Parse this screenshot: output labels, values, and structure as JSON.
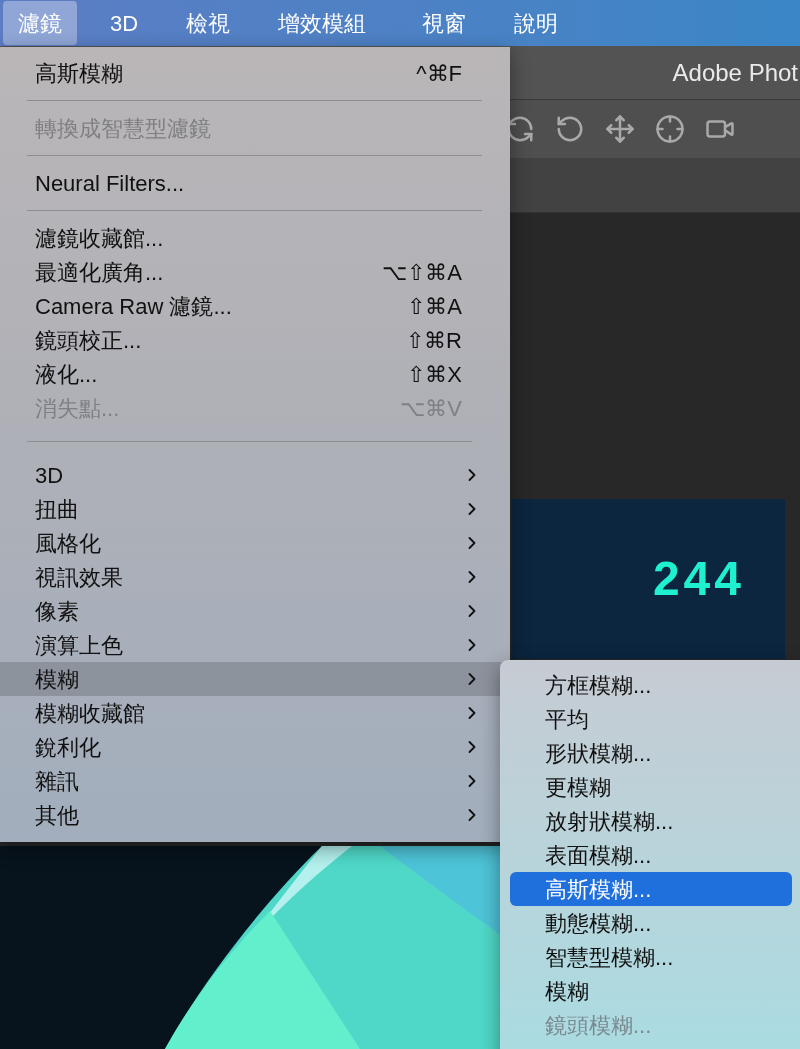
{
  "menubar": [
    {
      "label": "濾鏡",
      "selected": true
    },
    {
      "label": "3D",
      "selected": false
    },
    {
      "label": "檢視",
      "selected": false
    },
    {
      "label": "增效模組",
      "selected": false
    },
    {
      "label": "視窗",
      "selected": false
    },
    {
      "label": "說明",
      "selected": false
    }
  ],
  "app_window": {
    "title": "Adobe Phot",
    "panel_value": "244"
  },
  "menu": {
    "sections": [
      [
        {
          "kind": "command",
          "label": "高斯模糊",
          "shortcut": "^⌘F",
          "disabled": false,
          "selected": false
        }
      ],
      [
        {
          "kind": "command",
          "label": "轉換成智慧型濾鏡",
          "disabled": true,
          "selected": false
        }
      ],
      [
        {
          "kind": "command",
          "label": "Neural Filters...",
          "disabled": false,
          "selected": false
        }
      ],
      [
        {
          "kind": "command",
          "label": "濾鏡收藏館...",
          "disabled": false,
          "selected": false
        },
        {
          "kind": "command",
          "label": "最適化廣角...",
          "shortcut": "⌥⇧⌘A",
          "disabled": false,
          "selected": false
        },
        {
          "kind": "command",
          "label": "Camera Raw 濾鏡...",
          "shortcut": "⇧⌘A",
          "disabled": false,
          "selected": false
        },
        {
          "kind": "command",
          "label": "鏡頭校正...",
          "shortcut": "⇧⌘R",
          "disabled": false,
          "selected": false
        },
        {
          "kind": "command",
          "label": "液化...",
          "shortcut": "⇧⌘X",
          "disabled": false,
          "selected": false
        },
        {
          "kind": "command",
          "label": "消失點...",
          "shortcut": "⌥⌘V",
          "disabled": true,
          "selected": false
        }
      ],
      [
        {
          "kind": "submenu",
          "label": "3D",
          "disabled": false,
          "selected": false
        },
        {
          "kind": "submenu",
          "label": "扭曲",
          "disabled": false,
          "selected": false
        },
        {
          "kind": "submenu",
          "label": "風格化",
          "disabled": false,
          "selected": false
        },
        {
          "kind": "submenu",
          "label": "視訊效果",
          "disabled": false,
          "selected": false
        },
        {
          "kind": "submenu",
          "label": "像素",
          "disabled": false,
          "selected": false
        },
        {
          "kind": "submenu",
          "label": "演算上色",
          "disabled": false,
          "selected": false
        },
        {
          "kind": "submenu",
          "label": "模糊",
          "disabled": false,
          "selected": true
        },
        {
          "kind": "submenu",
          "label": "模糊收藏館",
          "disabled": false,
          "selected": false
        },
        {
          "kind": "submenu",
          "label": "銳利化",
          "disabled": false,
          "selected": false
        },
        {
          "kind": "submenu",
          "label": "雜訊",
          "disabled": false,
          "selected": false
        },
        {
          "kind": "submenu",
          "label": "其他",
          "disabled": false,
          "selected": false
        }
      ]
    ]
  },
  "submenu": [
    {
      "label": "方框模糊...",
      "disabled": false,
      "selected": false
    },
    {
      "label": "平均",
      "disabled": false,
      "selected": false
    },
    {
      "label": "形狀模糊...",
      "disabled": false,
      "selected": false
    },
    {
      "label": "更模糊",
      "disabled": false,
      "selected": false
    },
    {
      "label": "放射狀模糊...",
      "disabled": false,
      "selected": false
    },
    {
      "label": "表面模糊...",
      "disabled": false,
      "selected": false
    },
    {
      "label": "高斯模糊...",
      "disabled": false,
      "selected": true
    },
    {
      "label": "動態模糊...",
      "disabled": false,
      "selected": false
    },
    {
      "label": "智慧型模糊...",
      "disabled": false,
      "selected": false
    },
    {
      "label": "模糊",
      "disabled": false,
      "selected": false
    },
    {
      "label": "鏡頭模糊...",
      "disabled": true,
      "selected": false
    }
  ]
}
